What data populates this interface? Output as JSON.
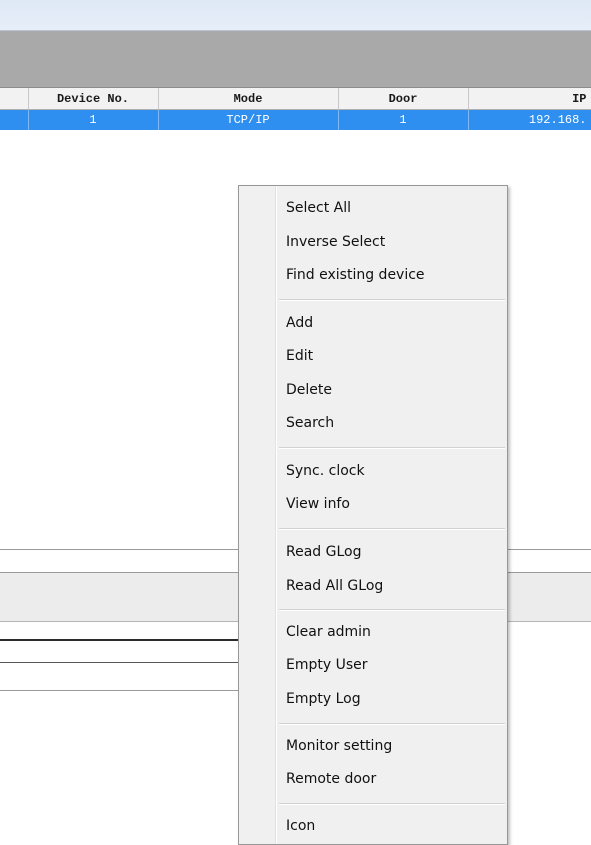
{
  "table": {
    "headers": [
      "Device No.",
      "Mode",
      "Door",
      "IP"
    ],
    "rows": [
      [
        "1",
        "TCP/IP",
        "1",
        "192.168."
      ]
    ]
  },
  "context_menu": {
    "groups": [
      [
        "Select All",
        "Inverse Select",
        "Find existing device"
      ],
      [
        "Add",
        "Edit",
        "Delete",
        "Search"
      ],
      [
        "Sync. clock",
        "View info"
      ],
      [
        "Read GLog",
        "Read All GLog"
      ],
      [
        "Clear admin",
        "Empty User",
        "Empty Log"
      ],
      [
        "Monitor setting",
        "Remote door"
      ],
      [
        "Icon"
      ]
    ]
  },
  "colors": {
    "selected_row": "#2e8ff0",
    "toolbar_band": "#a9a9a9",
    "menu_background": "#f0f0f0"
  }
}
